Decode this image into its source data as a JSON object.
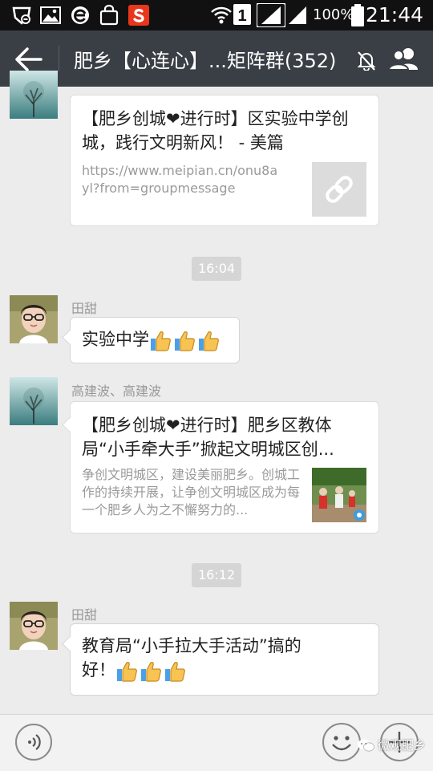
{
  "status_bar": {
    "sim_label": "1",
    "battery_text": "100%",
    "time": "21:44"
  },
  "header": {
    "title": "肥乡【心连心】...矩阵群(352)",
    "icons": [
      "back-arrow-icon",
      "mute-icon",
      "members-icon"
    ]
  },
  "messages": [
    {
      "type": "link_card",
      "title": "【肥乡创城❤进行时】区实验中学创城，践行文明新风！ - 美篇",
      "description": "https://www.meipian.cn/onu8ayl?from=groupmessage",
      "thumb_icon": "link-icon"
    },
    {
      "type": "time",
      "text": "16:04"
    },
    {
      "type": "text",
      "sender": "田甜",
      "text": "实验中学",
      "emoji": [
        "thumbs-up",
        "thumbs-up",
        "thumbs-up"
      ]
    },
    {
      "type": "link_card",
      "sender": "高建波、高建波",
      "title": "【肥乡创城❤进行时】肥乡区教体局“小手牵大手”掀起文明城区创...",
      "description": "争创文明城区，建设美丽肥乡。创城工作的持续开展，让争创文明城区成为每一个肥乡人为之不懈努力的..."
    },
    {
      "type": "time",
      "text": "16:12"
    },
    {
      "type": "text",
      "sender": "田甜",
      "text_line1": "教育局“小手拉大手活动”搞的",
      "text_line2": "好！",
      "emoji": [
        "thumbs-up",
        "thumbs-up",
        "thumbs-up"
      ]
    }
  ],
  "input_bar": {
    "icons": [
      "voice-icon",
      "emoji-icon",
      "plus-icon"
    ]
  },
  "watermark": {
    "text": "微观肥乡"
  },
  "colors": {
    "status_bar_bg": "#111111",
    "title_bar_bg": "#3a3f45",
    "chat_bg": "#ececec",
    "timestamp_bg": "#d5d5d5"
  }
}
